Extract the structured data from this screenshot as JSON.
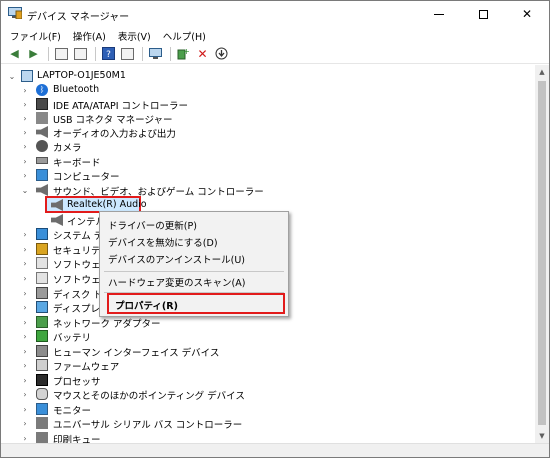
{
  "window": {
    "title": "デバイス マネージャー",
    "minimize_label": "—",
    "maximize_label": "",
    "close_label": "✕"
  },
  "menu": [
    "ファイル(F)",
    "操作(A)",
    "表示(V)",
    "ヘルプ(H)"
  ],
  "toolbar": {
    "back_glyph": "◀",
    "forward_glyph": "▶",
    "help_glyph": "?",
    "add_glyph": "+",
    "remove_glyph": "✕",
    "update_glyph": "⬇"
  },
  "tree": {
    "root": "LAPTOP-O1JE50M1",
    "categories": [
      "Bluetooth",
      "IDE ATA/ATAPI コントローラー",
      "USB コネクタ マネージャー",
      "オーディオの入力および出力",
      "カメラ",
      "キーボード",
      "コンピューター",
      "サウンド、ビデオ、およびゲーム コントローラー",
      "Realtek(R) Audio",
      "インテル(R",
      "システム デバイ",
      "セキュリティ デ",
      "ソフトウェア コン",
      "ソフトウェア デバ",
      "ディスク ドライブ",
      "ディスプレイ ア",
      "ネットワーク アダプター",
      "バッテリ",
      "ヒューマン インターフェイス デバイス",
      "ファームウェア",
      "プロセッサ",
      "マウスとそのほかのポインティング デバイス",
      "モニター",
      "ユニバーサル シリアル バス コントローラー",
      "印刷キュー"
    ]
  },
  "context_menu": {
    "update_driver": "ドライバーの更新(P)",
    "disable_device": "デバイスを無効にする(D)",
    "uninstall_device": "デバイスのアンインストール(U)",
    "scan_hardware": "ハードウェア変更のスキャン(A)",
    "properties": "プロパティ(R)"
  },
  "colors": {
    "highlight": "#e21b1b",
    "selection": "#cce8ff"
  }
}
